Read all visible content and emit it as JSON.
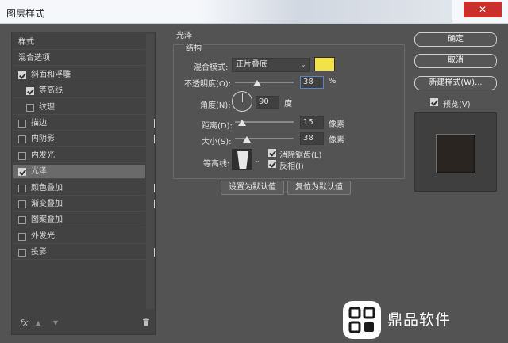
{
  "window": {
    "title": "图层样式",
    "close_icon": "close-icon"
  },
  "left_list": {
    "items": [
      {
        "label": "样式",
        "checkbox": false,
        "checked": false,
        "plus": false,
        "selected": false,
        "indent": 0
      },
      {
        "label": "混合选项",
        "checkbox": false,
        "checked": false,
        "plus": false,
        "selected": false,
        "indent": 0
      },
      {
        "label": "斜面和浮雕",
        "checkbox": true,
        "checked": true,
        "plus": false,
        "selected": false,
        "indent": 0
      },
      {
        "label": "等高线",
        "checkbox": true,
        "checked": true,
        "plus": false,
        "selected": false,
        "indent": 1
      },
      {
        "label": "纹理",
        "checkbox": true,
        "checked": false,
        "plus": false,
        "selected": false,
        "indent": 1
      },
      {
        "label": "描边",
        "checkbox": true,
        "checked": false,
        "plus": true,
        "selected": false,
        "indent": 0
      },
      {
        "label": "内阴影",
        "checkbox": true,
        "checked": false,
        "plus": true,
        "selected": false,
        "indent": 0
      },
      {
        "label": "内发光",
        "checkbox": true,
        "checked": false,
        "plus": false,
        "selected": false,
        "indent": 0
      },
      {
        "label": "光泽",
        "checkbox": true,
        "checked": true,
        "plus": false,
        "selected": true,
        "indent": 0
      },
      {
        "label": "颜色叠加",
        "checkbox": true,
        "checked": false,
        "plus": true,
        "selected": false,
        "indent": 0
      },
      {
        "label": "渐变叠加",
        "checkbox": true,
        "checked": false,
        "plus": true,
        "selected": false,
        "indent": 0
      },
      {
        "label": "图案叠加",
        "checkbox": true,
        "checked": false,
        "plus": false,
        "selected": false,
        "indent": 0
      },
      {
        "label": "外发光",
        "checkbox": true,
        "checked": false,
        "plus": false,
        "selected": false,
        "indent": 0
      },
      {
        "label": "投影",
        "checkbox": true,
        "checked": false,
        "plus": true,
        "selected": false,
        "indent": 0
      }
    ],
    "bottom_icons": {
      "fx": "fx",
      "up": "▲",
      "down": "▼",
      "trash": "trash-icon"
    }
  },
  "satin": {
    "section_title": "光泽",
    "group_title": "结构",
    "blend_mode_label": "混合模式:",
    "blend_mode_value": "正片叠底",
    "color": "#f2e24a",
    "opacity_label": "不透明度(O):",
    "opacity_value": "38",
    "opacity_unit": "%",
    "opacity_level": 0.38,
    "angle_label": "角度(N):",
    "angle_value": "90",
    "angle_unit": "度",
    "distance_label": "距离(D):",
    "distance_value": "15",
    "distance_unit": "像素",
    "size_label": "大小(S):",
    "size_value": "38",
    "size_unit": "像素",
    "contour_label": "等高线:",
    "antialias_label": "消除锯齿(L)",
    "invert_label": "反相(I)",
    "set_default": "设置为默认值",
    "reset_default": "复位为默认值"
  },
  "right": {
    "ok": "确定",
    "cancel": "取消",
    "new_style": "新建样式(W)...",
    "preview_label": "预览(V)",
    "preview_checked": true
  },
  "watermark": {
    "text": "鼎品软件"
  }
}
